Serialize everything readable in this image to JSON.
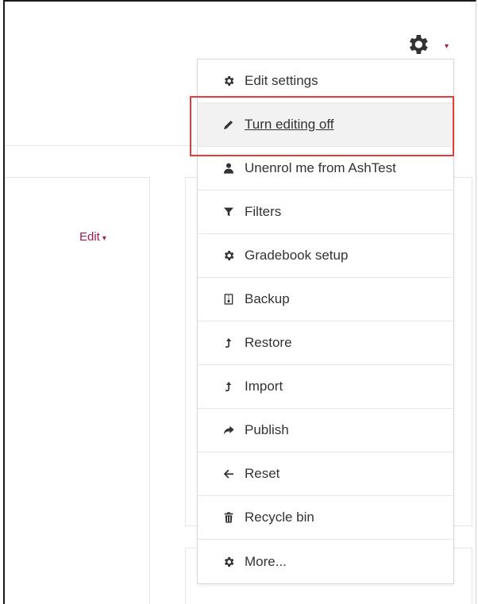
{
  "page": {
    "edit_link_label": "Edit",
    "caret": "▾"
  },
  "settings_menu": {
    "toggle_icon": "gear-icon",
    "accent_color": "#a5194f",
    "highlight_color": "#e43b3b",
    "items": [
      {
        "label": "Edit settings",
        "icon": "gear-icon"
      },
      {
        "label": "Turn editing off",
        "icon": "pencil-icon",
        "highlighted": true
      },
      {
        "label": "Unenrol me from AshTest",
        "icon": "user-icon"
      },
      {
        "label": "Filters",
        "icon": "filter-icon"
      },
      {
        "label": "Gradebook setup",
        "icon": "gear-icon"
      },
      {
        "label": "Backup",
        "icon": "file-zip-icon"
      },
      {
        "label": "Restore",
        "icon": "upload-icon"
      },
      {
        "label": "Import",
        "icon": "upload-icon"
      },
      {
        "label": "Publish",
        "icon": "share-icon"
      },
      {
        "label": "Reset",
        "icon": "arrow-left-icon"
      },
      {
        "label": "Recycle bin",
        "icon": "trash-icon"
      },
      {
        "label": "More...",
        "icon": "gear-icon"
      }
    ]
  }
}
